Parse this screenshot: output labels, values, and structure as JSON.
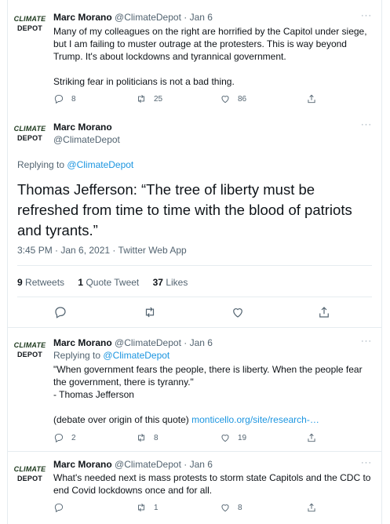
{
  "avatar": {
    "line1": "CLIMATE",
    "line2": "DEPOT"
  },
  "tweet1": {
    "name": "Marc Morano",
    "handle_date": "@ClimateDepot · Jan 6",
    "line1": "Many of my colleagues on the right are horrified by the Capitol under siege,",
    "line2": "but I am failing to muster outrage at the protesters. This is way beyond",
    "line3": "Trump. It's about lockdowns and tyrannical government.",
    "line4": "Striking fear in politicians is not a bad thing.",
    "replies": "8",
    "retweets": "25",
    "likes": "86"
  },
  "main": {
    "name": "Marc Morano",
    "handle": "@ClimateDepot",
    "replying_prefix": "Replying to",
    "replying_handle": "@ClimateDepot",
    "line1": "Thomas Jefferson: “The tree of liberty must be",
    "line2": "refreshed from time to time with the blood of patriots",
    "line3": "and tyrants.”",
    "meta": "3:45 PM · Jan 6, 2021 · Twitter Web App",
    "retweets_count": "9",
    "retweets_label": "Retweets",
    "quote_count": "1",
    "quote_label": "Quote Tweet",
    "likes_count": "37",
    "likes_label": "Likes"
  },
  "tweet3": {
    "name": "Marc Morano",
    "handle_date": "@ClimateDepot · Jan 6",
    "replying_prefix": "Replying to",
    "replying_handle": "@ClimateDepot",
    "line1": "\"When government fears the people, there is liberty. When the people fear",
    "line2": "the government, there is tyranny.\"",
    "line3": "- Thomas Jefferson",
    "line4_prefix": "(debate over origin of this quote)",
    "line4_link": "monticello.org/site/research-…",
    "replies": "2",
    "retweets": "8",
    "likes": "19"
  },
  "tweet4": {
    "name": "Marc Morano",
    "handle_date": "@ClimateDepot · Jan 6",
    "line1": "What's needed next is mass protests to storm state Capitols and the CDC to",
    "line2": "end Covid lockdowns once and for all.",
    "replies": "",
    "retweets": "1",
    "likes": "8"
  },
  "more_glyph": "···",
  "icons": [
    "reply-icon",
    "retweet-icon",
    "like-icon",
    "share-icon"
  ]
}
